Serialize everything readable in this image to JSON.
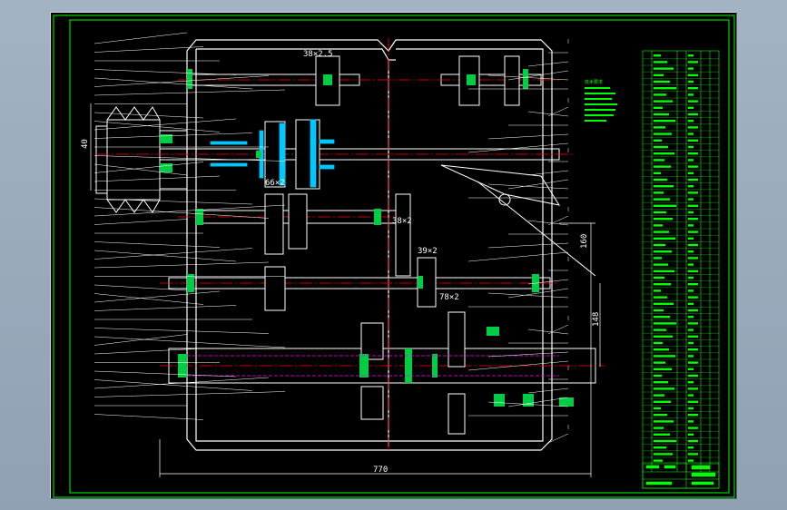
{
  "labels": {
    "gear_1": "38×2.5",
    "gear_2": "38×2",
    "gear_3": "39×2",
    "gear_4": "78×2",
    "gear_5": "66×2",
    "dim_bottom": "770",
    "dim_right_1": "160",
    "dim_right_2": "148",
    "dim_left": "40",
    "notes_title": "技术要求"
  },
  "colors": {
    "frame": "#00ff00",
    "housing": "#ffffff",
    "centerline": "#ff0000",
    "section": "#00cc44",
    "shaft_fill": "#00c8ff",
    "highlight": "#ff00ff",
    "leader": "#ffffff"
  }
}
